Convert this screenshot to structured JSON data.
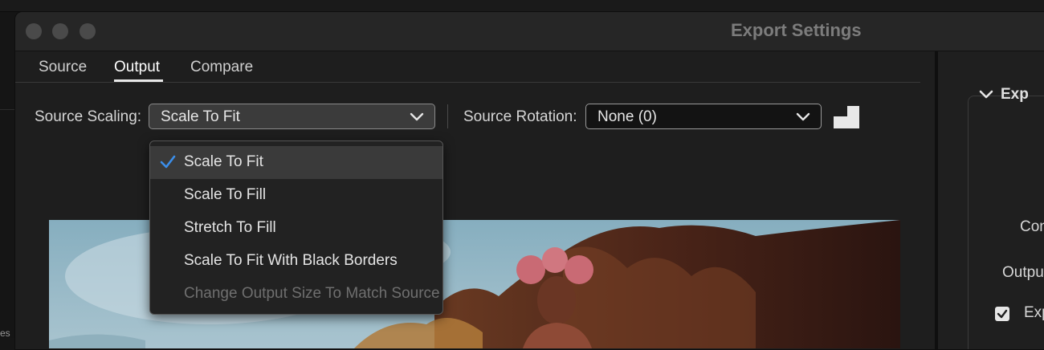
{
  "window": {
    "title": "Export Settings"
  },
  "tabs": [
    {
      "label": "Source",
      "active": false
    },
    {
      "label": "Output",
      "active": true
    },
    {
      "label": "Compare",
      "active": false
    }
  ],
  "source_scaling": {
    "label": "Source Scaling:",
    "value": "Scale To Fit",
    "options": [
      {
        "label": "Scale To Fit",
        "checked": true,
        "disabled": false
      },
      {
        "label": "Scale To Fill",
        "checked": false,
        "disabled": false
      },
      {
        "label": "Stretch To Fill",
        "checked": false,
        "disabled": false
      },
      {
        "label": "Scale To Fit With Black Borders",
        "checked": false,
        "disabled": false
      },
      {
        "label": "Change Output Size To Match Source",
        "checked": false,
        "disabled": true
      }
    ]
  },
  "source_rotation": {
    "label": "Source Rotation:",
    "value": "None (0)"
  },
  "right_panel": {
    "section_title": "Exp",
    "label_1": "Con",
    "label_2": "Outpu",
    "checkbox_label": "Exp"
  },
  "background": {
    "corner_text": "es"
  },
  "colors": {
    "check_blue": "#3b8eea",
    "window_bg": "#1f1f1f",
    "titlebar_bg": "#262626"
  }
}
